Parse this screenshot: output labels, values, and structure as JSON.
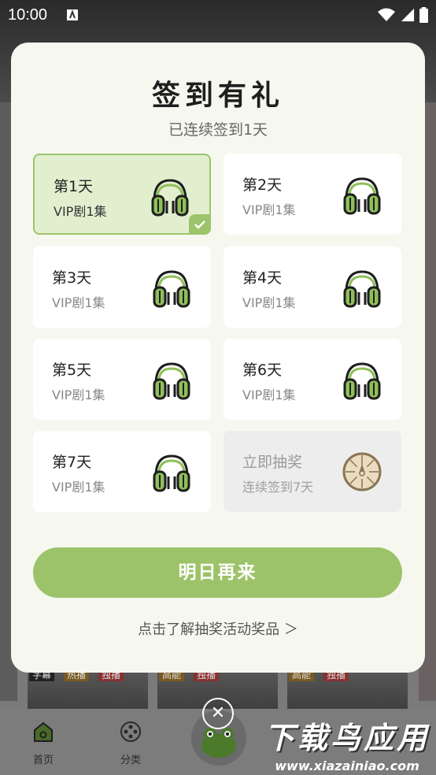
{
  "status_bar": {
    "time": "10:00"
  },
  "modal": {
    "title": "签到有礼",
    "subtitle": "已连续签到1天",
    "days": [
      {
        "title": "第1天",
        "reward": "VIP剧1集",
        "state": "checked"
      },
      {
        "title": "第2天",
        "reward": "VIP剧1集",
        "state": "pending"
      },
      {
        "title": "第3天",
        "reward": "VIP剧1集",
        "state": "pending"
      },
      {
        "title": "第4天",
        "reward": "VIP剧1集",
        "state": "pending"
      },
      {
        "title": "第5天",
        "reward": "VIP剧1集",
        "state": "pending"
      },
      {
        "title": "第6天",
        "reward": "VIP剧1集",
        "state": "pending"
      },
      {
        "title": "第7天",
        "reward": "VIP剧1集",
        "state": "pending"
      }
    ],
    "lottery": {
      "title": "立即抽奖",
      "subtitle": "连续签到7天"
    },
    "cta_label": "明日再来",
    "lottery_link": "点击了解抽奖活动奖品 ＞"
  },
  "background": {
    "card_tags": [
      [
        "字幕",
        "热播",
        "独播"
      ],
      [
        "高能",
        "独播"
      ],
      [
        "高能",
        "独播"
      ]
    ],
    "tabs": [
      {
        "label": "首页",
        "icon": "home-icon"
      },
      {
        "label": "分类",
        "icon": "film-reel-icon"
      }
    ]
  },
  "watermark": {
    "title": "下载鸟应用",
    "url": "www.xiazainiao.com"
  },
  "colors": {
    "accent": "#9dc36a",
    "active_bg": "#e2efcf",
    "modal_bg": "#f6f8f0"
  }
}
